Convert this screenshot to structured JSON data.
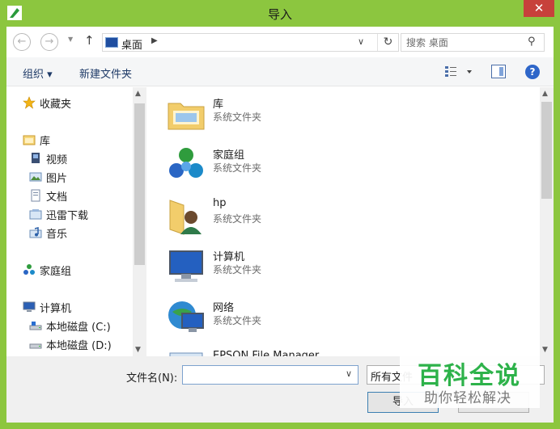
{
  "window": {
    "title": "导入",
    "close_glyph": "✕",
    "accent": "#8cc63f"
  },
  "address": {
    "location": "桌面",
    "search_placeholder": "搜索 桌面"
  },
  "toolbar": {
    "organize": "组织 ▾",
    "new_folder": "新建文件夹",
    "help": "?"
  },
  "nav": {
    "favorites": "收藏夹",
    "libraries": "库",
    "videos": "视频",
    "pictures": "图片",
    "documents": "文档",
    "thunder": "迅雷下载",
    "music": "音乐",
    "homegroup": "家庭组",
    "computer": "计算机",
    "drive_c": "本地磁盘 (C:)",
    "drive_d": "本地磁盘 (D:)"
  },
  "files": [
    {
      "name": "库",
      "type": "系统文件夹",
      "icon": "library-icon"
    },
    {
      "name": "家庭组",
      "type": "系统文件夹",
      "icon": "homegroup-icon"
    },
    {
      "name": "hp",
      "type": "系统文件夹",
      "icon": "user-folder-icon"
    },
    {
      "name": "计算机",
      "type": "系统文件夹",
      "icon": "computer-icon"
    },
    {
      "name": "网络",
      "type": "系统文件夹",
      "icon": "network-icon"
    },
    {
      "name": "EPSON File Manager",
      "type": "",
      "icon": "app-icon"
    }
  ],
  "bottom": {
    "filename_label": "文件名(N):",
    "filename_value": "",
    "filetype": "所有文件",
    "import_button": "导入",
    "cancel_button": "取消"
  },
  "watermark": {
    "title": "百科全说",
    "subtitle": "助你轻松解决"
  }
}
